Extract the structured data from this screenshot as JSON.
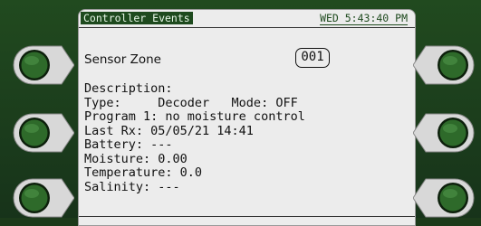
{
  "title_bar": {
    "screen_name": "Controller Events",
    "datetime": "WED 5:43:40 PM"
  },
  "sensor_zone": {
    "label": "Sensor Zone",
    "number": "001"
  },
  "details": {
    "description": "Description:",
    "type": "Type:     Decoder   Mode: OFF",
    "program": "Program 1: no moisture control",
    "last_rx": "Last Rx: 05/05/21 14:41",
    "battery": "Battery: ---",
    "moisture": "Moisture: 0.00",
    "temperature": "Temperature: 0.0",
    "salinity": "Salinity: ---"
  },
  "soft_buttons": {
    "left": [
      "soft-key-left-1",
      "soft-key-left-2",
      "soft-key-left-3"
    ],
    "right": [
      "soft-key-right-1",
      "soft-key-right-2",
      "soft-key-right-3"
    ]
  },
  "colors": {
    "panel": "#1c3a1a",
    "screen": "#ececec",
    "button_green": "#2e6a2a",
    "title_highlight": "#1e4a1e"
  }
}
